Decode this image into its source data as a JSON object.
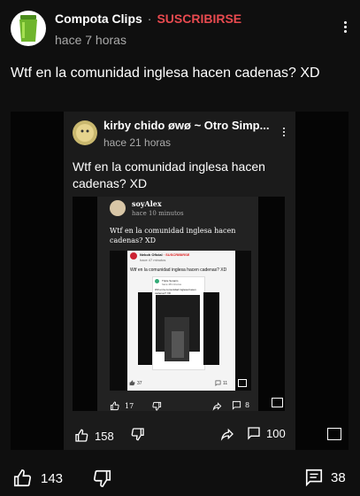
{
  "post": {
    "channel": "Compota Clips",
    "separator": "·",
    "subscribe": "SUSCRIBIRSE",
    "time": "hace 7 horas",
    "text": "Wtf en la comunidad inglesa hacen cadenas? XD",
    "likes": "143",
    "comments": "38"
  },
  "embed1": {
    "author": "kirby chido øwø  ~ Otro Simp...",
    "time": "hace 21 horas",
    "text": "Wtf en la comunidad inglesa hacen cadenas? XD",
    "likes": "158",
    "comments": "100"
  },
  "embed2": {
    "author": "soyAlex",
    "time": "hace 10 minutos",
    "text": "Wtf en la comunidad inglesa hacen cadenas? XD",
    "likes": "17",
    "comments": "8"
  },
  "embed3": {
    "author": "Nekoh Oficial",
    "subscribe": "· SUSCRIBIRSE",
    "time": "hace 47 minutos",
    "text": "Wtf en la comunidad inglesa hacen cadenas? XD",
    "likes": "37",
    "comments": "11"
  },
  "embed4": {
    "author": "Triple Sonaim",
    "time": "hace 48 minutos",
    "text": "Wtf en la comunidad inglesa hacen cadenas? XD"
  },
  "colors": {
    "background": "#0f0f0f",
    "accent": "#e84a4f"
  }
}
